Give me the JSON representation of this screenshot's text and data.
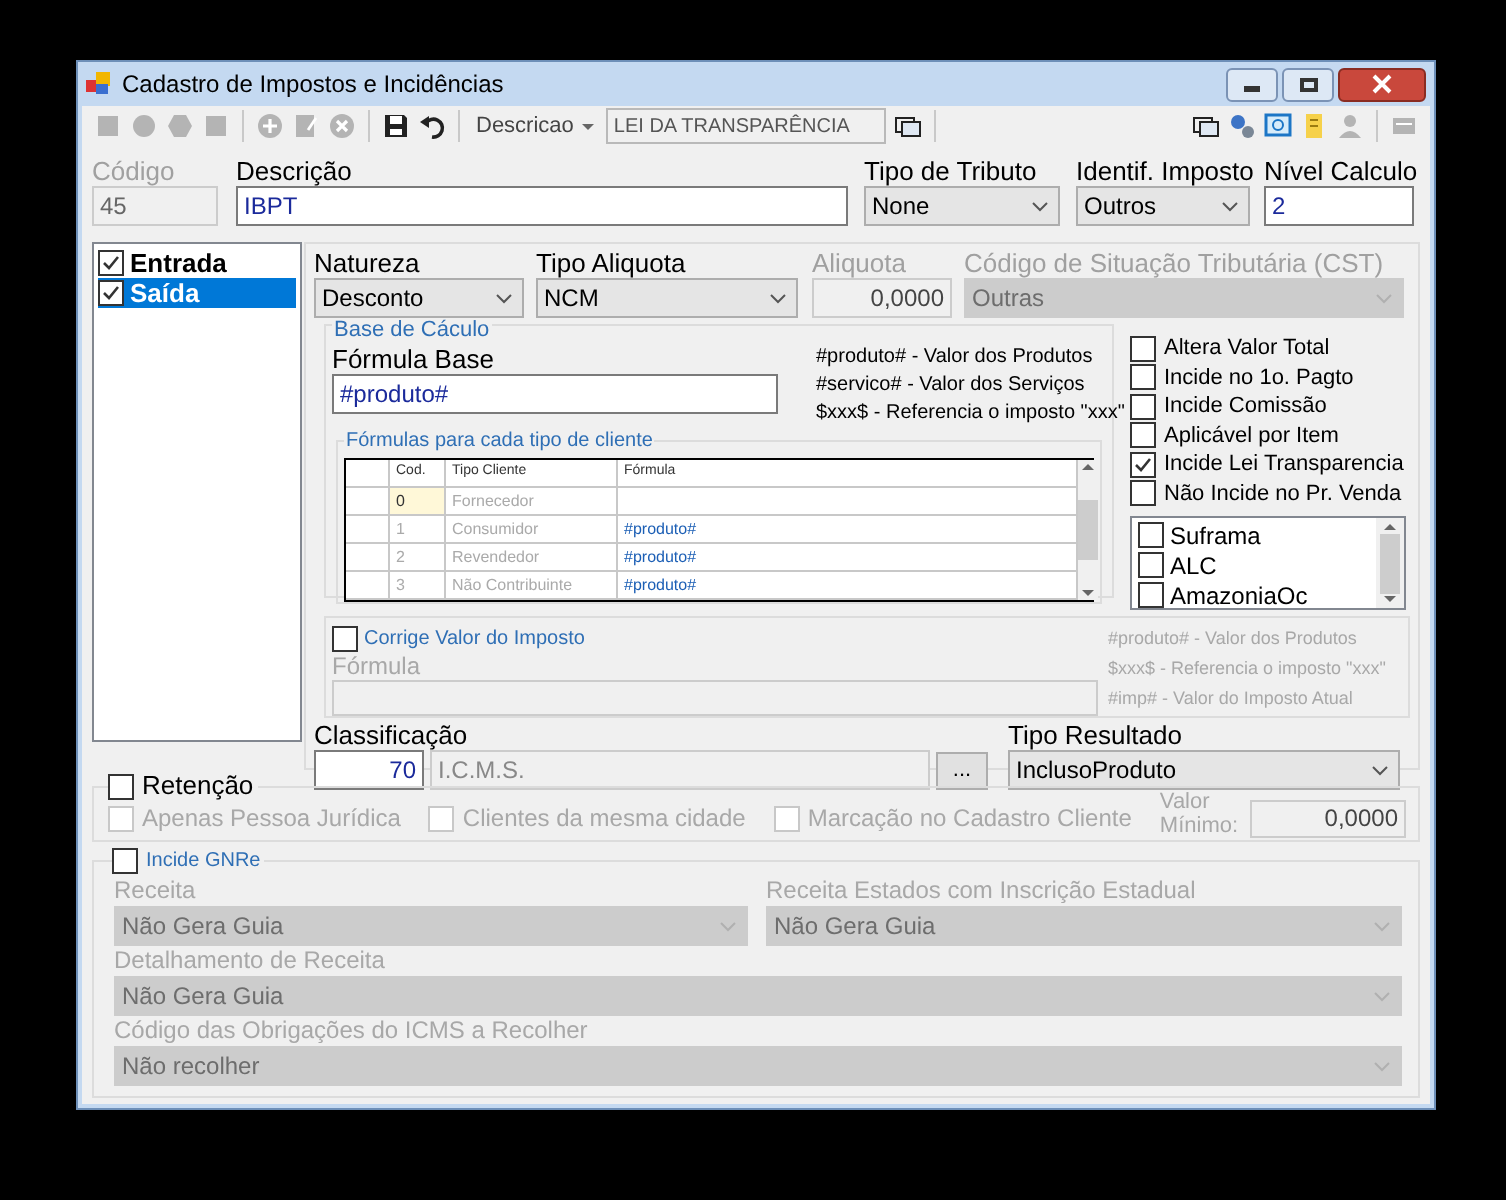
{
  "window": {
    "title": "Cadastro de Impostos e Incidências"
  },
  "toolbar": {
    "left_buttons": [
      {
        "disabled": true
      },
      {
        "disabled": true
      },
      {
        "disabled": true
      },
      {
        "disabled": true
      },
      {
        "disabled": true
      },
      {
        "disabled": true
      },
      {
        "disabled": true
      },
      {
        "disabled": false
      },
      {
        "disabled": false
      }
    ],
    "search_field_label": "Descricao",
    "search_value": "LEI DA TRANSPARÊNCIA",
    "right_buttons": [
      {
        "disabled": false
      },
      {
        "disabled": false
      },
      {
        "disabled": false
      },
      {
        "disabled": false
      },
      {
        "disabled": true
      },
      {
        "disabled": true
      }
    ]
  },
  "header": {
    "codigo": {
      "label": "Código",
      "value": "45",
      "disabled": true
    },
    "descricao": {
      "label": "Descrição",
      "value": "IBPT"
    },
    "tipo_tributo": {
      "label": "Tipo de Tributo",
      "value": "None"
    },
    "identif_imposto": {
      "label": "Identif. Imposto",
      "value": "Outros"
    },
    "nivel_calculo": {
      "label": "Nível Calculo",
      "value": "2"
    }
  },
  "operations": [
    {
      "label": "Entrada",
      "checked": true,
      "selected": false
    },
    {
      "label": "Saída",
      "checked": true,
      "selected": true
    }
  ],
  "natureza": {
    "label": "Natureza",
    "value": "Desconto"
  },
  "tipo_aliquota": {
    "label": "Tipo Aliquota",
    "value": "NCM"
  },
  "aliquota": {
    "label": "Aliquota",
    "value": "0,0000",
    "disabled": true
  },
  "cst": {
    "label": "Código de Situação Tributária (CST)",
    "value": "Outras",
    "disabled": true
  },
  "base_calculo": {
    "title": "Base de Cáculo",
    "formula_label": "Fórmula Base",
    "formula_value": "#produto#",
    "legend": [
      "#produto# - Valor dos Produtos",
      "#servico# - Valor dos Serviços",
      "$xxx$ - Referencia o imposto \"xxx\""
    ]
  },
  "formulas_grid": {
    "title": "Fórmulas para cada tipo de cliente",
    "columns": [
      "Cod.",
      "Tipo Cliente",
      "Fórmula"
    ],
    "rows": [
      {
        "cod": "0",
        "tipo": "Fornecedor",
        "formula": "",
        "selected": true
      },
      {
        "cod": "1",
        "tipo": "Consumidor",
        "formula": "#produto#",
        "selected": false
      },
      {
        "cod": "2",
        "tipo": "Revendedor",
        "formula": "#produto#",
        "selected": false
      },
      {
        "cod": "3",
        "tipo": "Não Contribuinte",
        "formula": "#produto#",
        "selected": false
      }
    ]
  },
  "options": [
    {
      "label": "Altera Valor Total",
      "checked": false
    },
    {
      "label": "Incide no 1o. Pagto",
      "checked": false
    },
    {
      "label": "Incide Comissão",
      "checked": false
    },
    {
      "label": "Aplicável por Item",
      "checked": false
    },
    {
      "label": "Incide Lei Transparencia",
      "checked": true
    },
    {
      "label": "Não Incide no Pr. Venda",
      "checked": false
    }
  ],
  "regions": [
    {
      "label": "Suframa",
      "checked": false
    },
    {
      "label": "ALC",
      "checked": false
    },
    {
      "label": "AmazoniaOc",
      "checked": false
    }
  ],
  "corrige": {
    "label": "Corrige Valor do Imposto",
    "checked": false,
    "formula_label": "Fórmula",
    "legend": [
      "#produto# - Valor dos Produtos",
      "$xxx$ - Referencia o imposto \"xxx\"",
      "#imp# - Valor do Imposto Atual"
    ]
  },
  "classificacao": {
    "label": "Classificação",
    "code": "70",
    "description": "I.C.M.S.",
    "button": "..."
  },
  "tipo_resultado": {
    "label": "Tipo Resultado",
    "value": "InclusoProduto"
  },
  "retencao": {
    "label": "Retenção",
    "checked": false,
    "options": [
      {
        "label": "Apenas Pessoa Jurídica",
        "checked": false,
        "disabled": true
      },
      {
        "label": "Clientes da mesma cidade",
        "checked": false,
        "disabled": true
      },
      {
        "label": "Marcação no Cadastro Cliente",
        "checked": false,
        "disabled": true
      }
    ],
    "valor_minimo_label": "Valor Mínimo:",
    "valor_minimo": "0,0000"
  },
  "gnre": {
    "label": "Incide GNRe",
    "checked": false,
    "receita": {
      "label": "Receita",
      "value": "Não Gera Guia"
    },
    "receita_estados": {
      "label": "Receita Estados com Inscrição Estadual",
      "value": "Não Gera Guia"
    },
    "detalhamento": {
      "label": "Detalhamento de Receita",
      "value": "Não Gera Guia"
    },
    "obrigacoes": {
      "label": "Código das Obrigações do ICMS a Recolher",
      "value": "Não recolher"
    }
  }
}
